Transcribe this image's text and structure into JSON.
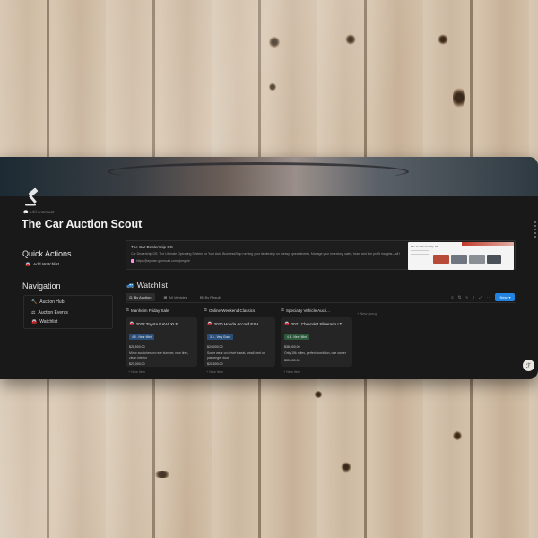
{
  "page": {
    "add_comment": "Add comment",
    "title": "The Car Auction Scout"
  },
  "quick_actions": {
    "title": "Quick Actions",
    "items": [
      {
        "label": "Add Watchlist"
      }
    ]
  },
  "navigation": {
    "title": "Navigation",
    "items": [
      {
        "label": "Auction Hub"
      },
      {
        "label": "Auction Events"
      },
      {
        "label": "Watchlist"
      }
    ]
  },
  "info_card": {
    "title": "The Car Dealership OS",
    "description": "Car Dealership OS: The Ultimate Operating System for Your Auto BusinessStop running your dealership on messy spreadsheets. Manage your inventory, sales, team and live profit margins—all from one p",
    "link": "https://jfaymisn.gumroad.com/l/pmgnle",
    "thumb_title": "The Car Dealership OS"
  },
  "watchlist": {
    "title": "Watchlist",
    "tabs": [
      {
        "label": "By Auction"
      },
      {
        "label": "All Vehicles"
      },
      {
        "label": "By Result"
      }
    ],
    "new_label": "New",
    "new_group": "+ New group",
    "new_item": "+ New item",
    "columns": [
      {
        "name": "Manheim Friday Sale",
        "card": {
          "title": "2022 Toyota RAV4 XLE",
          "badge": "4.5 - Near Mint",
          "badge_color": "#2b4f7a",
          "price": "$28,500.00",
          "notes": "Minor scratches on rear bumper, new tires, clean interior",
          "price2": "$23,000.00"
        }
      },
      {
        "name": "Online Weekend Classics",
        "card": {
          "title": "2020 Honda Accord EX-L",
          "badge": "3.5 - Very Good",
          "badge_color": "#2b4f7a",
          "price": "$24,000.00",
          "notes": "Some wear on driver's seat, small dent on passenger door",
          "price2": "$21,500.00"
        }
      },
      {
        "name": "Specialty Vehicle Aucti...",
        "card": {
          "title": "2021 Chevrolet Silverado LT",
          "badge": "4.8 - Near Mint",
          "badge_color": "#2d5a3d",
          "price": "$38,000.00",
          "notes": "Only 15k miles, perfect condition, one owner",
          "price2": "$33,000.00"
        }
      }
    ]
  },
  "colors": {
    "app_bg": "#191919",
    "accent": "#2383e2"
  }
}
